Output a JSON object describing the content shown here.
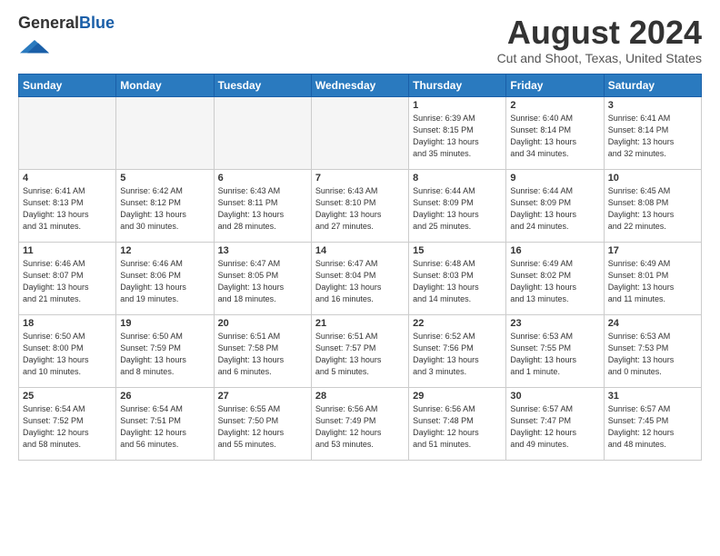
{
  "header": {
    "logo_general": "General",
    "logo_blue": "Blue",
    "month_title": "August 2024",
    "location": "Cut and Shoot, Texas, United States"
  },
  "weekdays": [
    "Sunday",
    "Monday",
    "Tuesday",
    "Wednesday",
    "Thursday",
    "Friday",
    "Saturday"
  ],
  "weeks": [
    [
      {
        "day": "",
        "info": ""
      },
      {
        "day": "",
        "info": ""
      },
      {
        "day": "",
        "info": ""
      },
      {
        "day": "",
        "info": ""
      },
      {
        "day": "1",
        "info": "Sunrise: 6:39 AM\nSunset: 8:15 PM\nDaylight: 13 hours\nand 35 minutes."
      },
      {
        "day": "2",
        "info": "Sunrise: 6:40 AM\nSunset: 8:14 PM\nDaylight: 13 hours\nand 34 minutes."
      },
      {
        "day": "3",
        "info": "Sunrise: 6:41 AM\nSunset: 8:14 PM\nDaylight: 13 hours\nand 32 minutes."
      }
    ],
    [
      {
        "day": "4",
        "info": "Sunrise: 6:41 AM\nSunset: 8:13 PM\nDaylight: 13 hours\nand 31 minutes."
      },
      {
        "day": "5",
        "info": "Sunrise: 6:42 AM\nSunset: 8:12 PM\nDaylight: 13 hours\nand 30 minutes."
      },
      {
        "day": "6",
        "info": "Sunrise: 6:43 AM\nSunset: 8:11 PM\nDaylight: 13 hours\nand 28 minutes."
      },
      {
        "day": "7",
        "info": "Sunrise: 6:43 AM\nSunset: 8:10 PM\nDaylight: 13 hours\nand 27 minutes."
      },
      {
        "day": "8",
        "info": "Sunrise: 6:44 AM\nSunset: 8:09 PM\nDaylight: 13 hours\nand 25 minutes."
      },
      {
        "day": "9",
        "info": "Sunrise: 6:44 AM\nSunset: 8:09 PM\nDaylight: 13 hours\nand 24 minutes."
      },
      {
        "day": "10",
        "info": "Sunrise: 6:45 AM\nSunset: 8:08 PM\nDaylight: 13 hours\nand 22 minutes."
      }
    ],
    [
      {
        "day": "11",
        "info": "Sunrise: 6:46 AM\nSunset: 8:07 PM\nDaylight: 13 hours\nand 21 minutes."
      },
      {
        "day": "12",
        "info": "Sunrise: 6:46 AM\nSunset: 8:06 PM\nDaylight: 13 hours\nand 19 minutes."
      },
      {
        "day": "13",
        "info": "Sunrise: 6:47 AM\nSunset: 8:05 PM\nDaylight: 13 hours\nand 18 minutes."
      },
      {
        "day": "14",
        "info": "Sunrise: 6:47 AM\nSunset: 8:04 PM\nDaylight: 13 hours\nand 16 minutes."
      },
      {
        "day": "15",
        "info": "Sunrise: 6:48 AM\nSunset: 8:03 PM\nDaylight: 13 hours\nand 14 minutes."
      },
      {
        "day": "16",
        "info": "Sunrise: 6:49 AM\nSunset: 8:02 PM\nDaylight: 13 hours\nand 13 minutes."
      },
      {
        "day": "17",
        "info": "Sunrise: 6:49 AM\nSunset: 8:01 PM\nDaylight: 13 hours\nand 11 minutes."
      }
    ],
    [
      {
        "day": "18",
        "info": "Sunrise: 6:50 AM\nSunset: 8:00 PM\nDaylight: 13 hours\nand 10 minutes."
      },
      {
        "day": "19",
        "info": "Sunrise: 6:50 AM\nSunset: 7:59 PM\nDaylight: 13 hours\nand 8 minutes."
      },
      {
        "day": "20",
        "info": "Sunrise: 6:51 AM\nSunset: 7:58 PM\nDaylight: 13 hours\nand 6 minutes."
      },
      {
        "day": "21",
        "info": "Sunrise: 6:51 AM\nSunset: 7:57 PM\nDaylight: 13 hours\nand 5 minutes."
      },
      {
        "day": "22",
        "info": "Sunrise: 6:52 AM\nSunset: 7:56 PM\nDaylight: 13 hours\nand 3 minutes."
      },
      {
        "day": "23",
        "info": "Sunrise: 6:53 AM\nSunset: 7:55 PM\nDaylight: 13 hours\nand 1 minute."
      },
      {
        "day": "24",
        "info": "Sunrise: 6:53 AM\nSunset: 7:53 PM\nDaylight: 13 hours\nand 0 minutes."
      }
    ],
    [
      {
        "day": "25",
        "info": "Sunrise: 6:54 AM\nSunset: 7:52 PM\nDaylight: 12 hours\nand 58 minutes."
      },
      {
        "day": "26",
        "info": "Sunrise: 6:54 AM\nSunset: 7:51 PM\nDaylight: 12 hours\nand 56 minutes."
      },
      {
        "day": "27",
        "info": "Sunrise: 6:55 AM\nSunset: 7:50 PM\nDaylight: 12 hours\nand 55 minutes."
      },
      {
        "day": "28",
        "info": "Sunrise: 6:56 AM\nSunset: 7:49 PM\nDaylight: 12 hours\nand 53 minutes."
      },
      {
        "day": "29",
        "info": "Sunrise: 6:56 AM\nSunset: 7:48 PM\nDaylight: 12 hours\nand 51 minutes."
      },
      {
        "day": "30",
        "info": "Sunrise: 6:57 AM\nSunset: 7:47 PM\nDaylight: 12 hours\nand 49 minutes."
      },
      {
        "day": "31",
        "info": "Sunrise: 6:57 AM\nSunset: 7:45 PM\nDaylight: 12 hours\nand 48 minutes."
      }
    ]
  ]
}
